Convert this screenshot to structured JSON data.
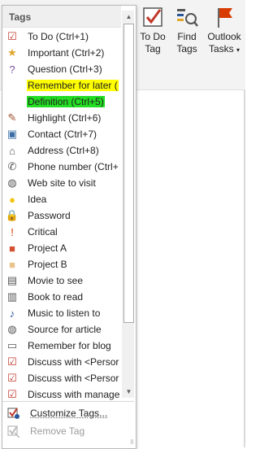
{
  "ribbon": {
    "buttons": [
      {
        "label": "To Do\nTag",
        "line1": "To Do",
        "line2": "Tag"
      },
      {
        "label": "Find\nTags",
        "line1": "Find",
        "line2": "Tags"
      },
      {
        "label": "Outlook\nTasks",
        "line1": "Outlook",
        "line2": "Tasks"
      }
    ]
  },
  "gallery": {
    "header": "Tags",
    "items": [
      {
        "label": "To Do (Ctrl+1)",
        "icon": "checkbox-checked-icon",
        "glyph": "☑",
        "color": "#c0392b"
      },
      {
        "label": "Important (Ctrl+2)",
        "icon": "star-icon",
        "glyph": "★",
        "color": "#e0a52a"
      },
      {
        "label": "Question (Ctrl+3)",
        "icon": "question-icon",
        "glyph": "?",
        "color": "#7b4fa0"
      },
      {
        "label": "Remember for later (",
        "icon": "none",
        "glyph": "",
        "highlight": "#ffff00"
      },
      {
        "label": "Definition (Ctrl+5)",
        "icon": "none",
        "glyph": "",
        "highlight": "#22dd22"
      },
      {
        "label": "Highlight (Ctrl+6)",
        "icon": "pen-icon",
        "glyph": "✎",
        "color": "#a0522d"
      },
      {
        "label": "Contact (Ctrl+7)",
        "icon": "contact-card-icon",
        "glyph": "▣",
        "color": "#3a6ea5"
      },
      {
        "label": "Address (Ctrl+8)",
        "icon": "house-icon",
        "glyph": "⌂",
        "color": "#555555"
      },
      {
        "label": "Phone number (Ctrl+",
        "icon": "phone-icon",
        "glyph": "✆",
        "color": "#555555"
      },
      {
        "label": "Web site to visit",
        "icon": "globe-icon",
        "glyph": "◍",
        "color": "#555555"
      },
      {
        "label": "Idea",
        "icon": "lightbulb-icon",
        "glyph": "●",
        "color": "#f1c40f"
      },
      {
        "label": "Password",
        "icon": "lock-icon",
        "glyph": "🔒",
        "color": "#c9a227"
      },
      {
        "label": "Critical",
        "icon": "exclamation-icon",
        "glyph": "!",
        "color": "#d83b01"
      },
      {
        "label": "Project A",
        "icon": "square-red-icon",
        "glyph": "■",
        "color": "#d35230"
      },
      {
        "label": "Project B",
        "icon": "square-tan-icon",
        "glyph": "■",
        "color": "#e8c38a"
      },
      {
        "label": "Movie to see",
        "icon": "film-icon",
        "glyph": "▤",
        "color": "#555555"
      },
      {
        "label": "Book to read",
        "icon": "book-icon",
        "glyph": "▥",
        "color": "#555555"
      },
      {
        "label": "Music to listen to",
        "icon": "music-note-icon",
        "glyph": "♪",
        "color": "#2b579a"
      },
      {
        "label": "Source for article",
        "icon": "globe-icon",
        "glyph": "◍",
        "color": "#555555"
      },
      {
        "label": "Remember for blog",
        "icon": "speech-bubble-icon",
        "glyph": "▭",
        "color": "#555555"
      },
      {
        "label": "Discuss with <Persor",
        "icon": "person-checkbox-icon",
        "glyph": "☑",
        "color": "#c0392b"
      },
      {
        "label": "Discuss with <Persor",
        "icon": "person-checkbox-icon",
        "glyph": "☑",
        "color": "#c0392b"
      },
      {
        "label": "Discuss with manage",
        "icon": "person-checkbox-icon",
        "glyph": "☑",
        "color": "#c0392b"
      }
    ],
    "customize_label": "Customize Tags...",
    "remove_label": "Remove Tag"
  }
}
